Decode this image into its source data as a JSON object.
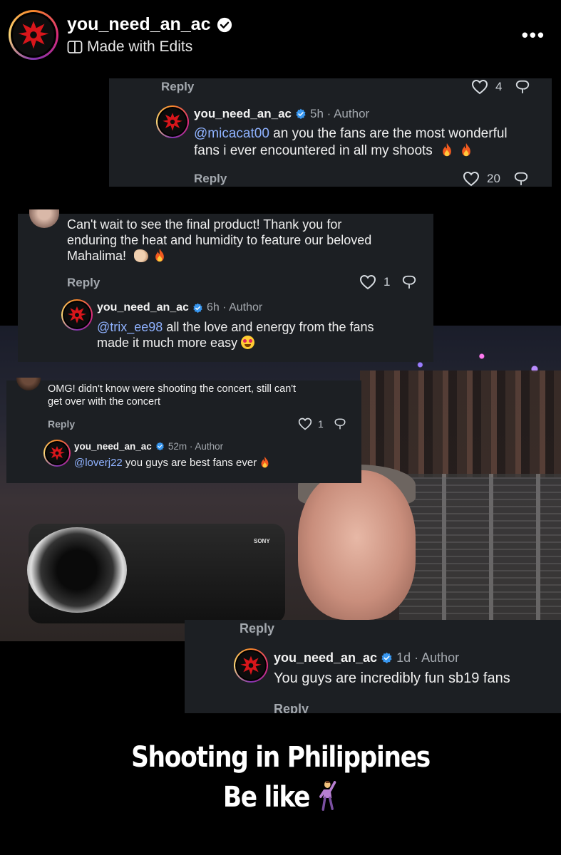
{
  "header": {
    "username": "you_need_an_ac",
    "subtitle": "Made with Edits",
    "more_label": "•••"
  },
  "panel1": {
    "top_reply": "Reply",
    "top_likes": "4",
    "author": "you_need_an_ac",
    "meta": "5h · Author",
    "mention": "@micacat00",
    "text_1": " an you the fans are the most wonderful",
    "text_2": "fans i ever encountered in all my shoots",
    "reply": "Reply",
    "likes": "20"
  },
  "panel2": {
    "comment_1": "Can't wait to see the final product! Thank you for",
    "comment_2": "enduring the heat and humidity to feature our beloved",
    "comment_3": "Mahalima!",
    "reply": "Reply",
    "likes": "1",
    "author": "you_need_an_ac",
    "meta": "6h · Author",
    "mention": "@trix_ee98",
    "text_1": " all the love and energy from the fans",
    "text_2": "made it much more easy"
  },
  "panel3": {
    "comment_1": "OMG! didn't know were shooting the concert, still can't",
    "comment_2": "get over with the concert",
    "reply": "Reply",
    "likes": "1",
    "author": "you_need_an_ac",
    "meta": "52m · Author",
    "mention": "@loverj22",
    "text_1": " you guys are best fans ever"
  },
  "panel4": {
    "top_reply": "Reply",
    "author": "you_need_an_ac",
    "meta": "1d · Author",
    "text_1": "You guys are incredibly fun sb19 fans",
    "reply": "Reply"
  },
  "photo": {
    "camera_brand": "SONY"
  },
  "caption": {
    "line_1": "Shooting in Philippines",
    "line_2": "Be like"
  },
  "colors": {
    "background": "#000000",
    "panel": "#1c1f23",
    "mention": "#8fb2ff",
    "verified": "#3897f0"
  },
  "icons": [
    "verified-icon",
    "edits-icon",
    "more-icon",
    "heart-icon",
    "dislike-icon",
    "fire-emoji",
    "clap-emoji",
    "heart-eyes-emoji",
    "dancing-person-emoji"
  ]
}
